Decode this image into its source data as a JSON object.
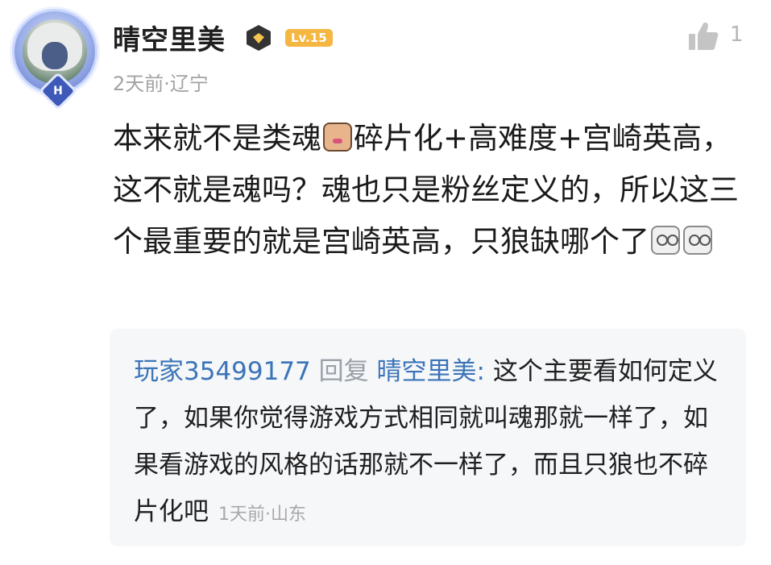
{
  "comment": {
    "username": "晴空里美",
    "level": "Lv.15",
    "likes": "1",
    "time": "2天前",
    "location": "辽宁",
    "meta_sep": "·",
    "text_part1": "本来就不是类魂",
    "text_part2": "碎片化+高难度+宫崎英高，这不就是魂吗？魂也只是粉丝定义的，所以这三个最重要的就是宫崎英高，只狼缺哪个了"
  },
  "reply": {
    "username": "玩家35499177",
    "action": "回复",
    "target": "晴空里美:",
    "text": "这个主要看如何定义了，如果你觉得游戏方式相同就叫魂那就一样了，如果看游戏的风格的话那就不一样了，而且只狼也不碎片化吧",
    "time": "1天前",
    "location": "山东",
    "meta_sep": "·"
  },
  "colors": {
    "level_badge": "#f5b642",
    "reply_name": "#3b74b8",
    "meta_gray": "#a3a3a3"
  },
  "icons": {
    "avatar_badge": "avatar-rank-badge",
    "vip": "vip-diamond-icon",
    "like": "thumbs-up-icon",
    "emoji_1": "thinking-emoji",
    "emoji_2": "doubt-emoji"
  }
}
